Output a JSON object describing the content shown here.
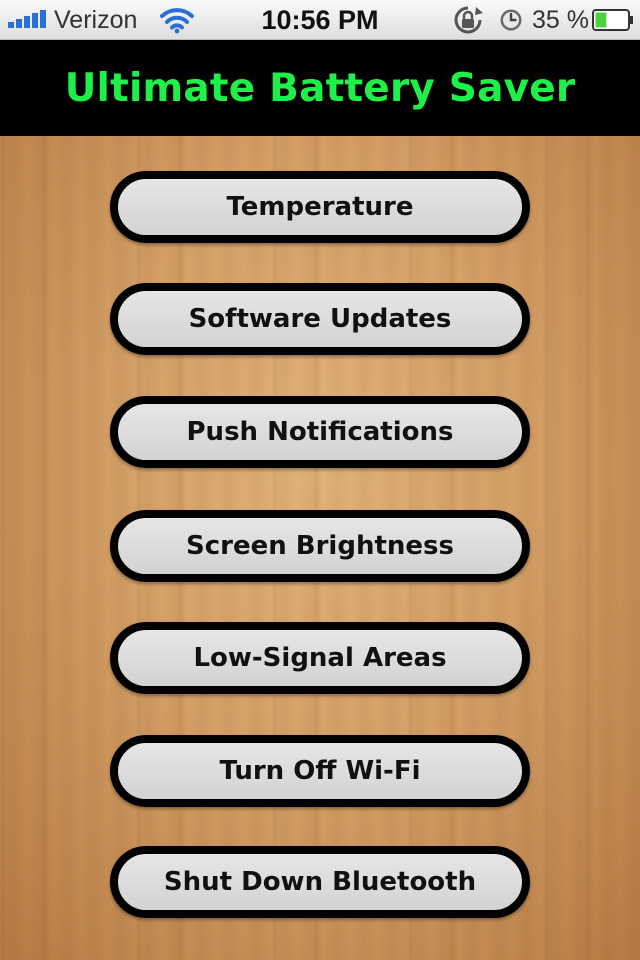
{
  "status_bar": {
    "carrier": "Verizon",
    "time": "10:56 PM",
    "battery_percent": "35 %",
    "battery_level": 0.35,
    "icons": [
      "signal-bars-icon",
      "wifi-icon",
      "rotation-lock-icon",
      "alarm-icon",
      "battery-icon"
    ]
  },
  "header": {
    "title": "Ultimate Battery Saver"
  },
  "menu": {
    "items": [
      {
        "label": "Temperature"
      },
      {
        "label": "Software Updates"
      },
      {
        "label": "Push Notifications"
      },
      {
        "label": "Screen Brightness"
      },
      {
        "label": "Low-Signal Areas"
      },
      {
        "label": "Turn Off Wi-Fi"
      },
      {
        "label": "Shut Down Bluetooth"
      }
    ]
  },
  "colors": {
    "title_green": "#1ef04a",
    "title_bar": "#000000",
    "button_fill": "#d9d9d9",
    "button_border": "#000000",
    "signal_blue": "#2a6fd6",
    "battery_green": "#4cd33a"
  }
}
